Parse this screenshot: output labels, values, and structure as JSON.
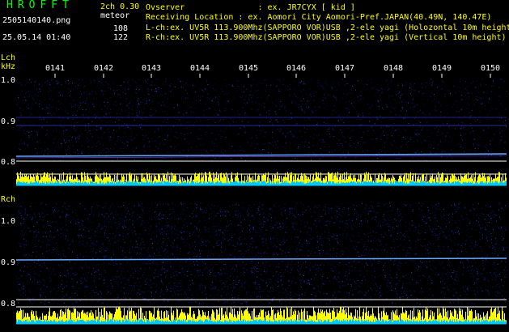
{
  "header": {
    "logo": "HROFFT",
    "version": "2ch 0.30",
    "filename": "2505140140.png",
    "datetime": "25.05.14 01:40",
    "meteor_label": "meteor",
    "count_l": "108",
    "count_r": "122",
    "observer": "Ovserver               : ex. JR7CYX [ kid ]",
    "location": "Receiving Location : ex. Aomori City Aomori-Pref.JAPAN(40.49N, 140.47E)",
    "lch_info": "L-ch:ex. UV5R 113.900Mhz(SAPPORO VOR)USB ,2-ele yagi (Holozontal 10m height)",
    "rch_info": "R-ch:ex. UV5R 113.900Mhz(SAPPORO VOR)USB ,2-ele yagi (Vertical 10m height)"
  },
  "labels": {
    "lch": "Lch",
    "khz": "kHz",
    "rch": "Rch"
  },
  "time_ticks": [
    "0141",
    "0142",
    "0143",
    "0144",
    "0145",
    "0146",
    "0147",
    "0148",
    "0149",
    "0150"
  ],
  "freq_ticks_l": [
    "1.0",
    "0.9",
    "0.8"
  ],
  "freq_ticks_r": [
    "1.0",
    "0.9",
    "0.8"
  ],
  "colors": {
    "background": "#000000",
    "text_white": "#ffffff",
    "text_yellow": "#ffff00",
    "text_cyan": "#00ffff",
    "logo_green": "#00ff00",
    "noise": "#1a1a8c",
    "signal_trace": "#66aaff",
    "level_bar": "#ffff00",
    "level_bar_low": "#00c8ff"
  }
}
